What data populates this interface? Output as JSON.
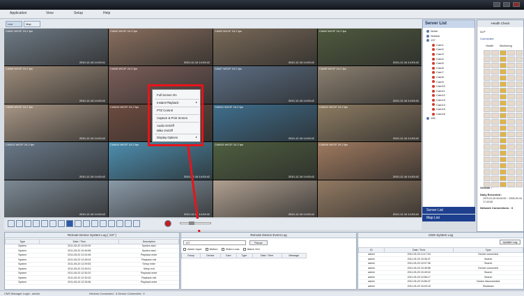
{
  "menu": {
    "items": [
      "Application",
      "View",
      "Setup",
      "Help"
    ]
  },
  "tabs": [
    {
      "label": "Live"
    },
    {
      "label": "Map"
    }
  ],
  "cameras": [
    {
      "label": "CAM1 W/CIF 24.2 fps",
      "ts": "2010-12-16 14:03:41"
    },
    {
      "label": "CAM2 W/CIF 24.2 fps",
      "ts": "2010-12-16 14:03:42"
    },
    {
      "label": "CAM3 W/CIF 24.2 fps",
      "ts": "2010-12-16 14:03:42"
    },
    {
      "label": "CAM4 W/CIF 24.2 fps",
      "ts": "2010-12-16 14:03:42"
    },
    {
      "label": "CAM5 W/CIF 24.2 fps",
      "ts": "2010-12-16 14:03:42"
    },
    {
      "label": "CAM6 W/CIF 24.2 fps",
      "ts": ""
    },
    {
      "label": "CAM7 W/CIF 24.2 fps",
      "ts": "2010-12-16 14:03:42"
    },
    {
      "label": "CAM8 W/CIF 24.2 fps",
      "ts": "2010-12-16 14:03:42"
    },
    {
      "label": "CAM9 W/CIF 24.2 fps",
      "ts": "2010-12-16 14:03:42"
    },
    {
      "label": "CAM10 W/CIF 24.2 fps",
      "ts": ""
    },
    {
      "label": "CAM11 W/CIF 24.2 fps",
      "ts": "2010-12-16 14:03:42"
    },
    {
      "label": "CAM12 W/CIF 24.2 fps",
      "ts": "2010-12-16 14:03:42"
    },
    {
      "label": "CAM13 W/CIF 24.2 fps",
      "ts": "2010-12-16 14:03:42"
    },
    {
      "label": "CAM14 W/CIF 24.2 fps",
      "ts": "2010-12-16 14:03:42"
    },
    {
      "label": "CAM15 W/CIF 24.2 fps",
      "ts": "2010-12-16 14:03:42"
    },
    {
      "label": "CAM16 W/CIF 24.2 fps",
      "ts": "2010-12-16 14:03:42"
    },
    {
      "label": "",
      "ts": "2010-12-16 14:03:42"
    },
    {
      "label": "",
      "ts": "2010-12-16 14:03:42"
    },
    {
      "label": "",
      "ts": "2010-12-16 14:03:42"
    },
    {
      "label": "",
      "ts": "2010-12-16 14:03:42"
    }
  ],
  "context_menu": {
    "items": [
      "Full Screen On",
      "Instant Playback",
      "PTZ Control",
      "Capture & Print Screen",
      "Audio On/Off",
      "Mike On/Off",
      "Display Options"
    ]
  },
  "server_list": {
    "title": "Server List",
    "items": [
      "Nvine",
      "Nvision",
      "137",
      "Cam1",
      "Cam2",
      "Cam3",
      "Cam4",
      "Cam5",
      "Cam6",
      "Cam7",
      "Cam8",
      "Cam9",
      "Cam10",
      "Cam11",
      "Cam12",
      "Cam13",
      "Cam14",
      "Cam15",
      "Cam16",
      "155"
    ]
  },
  "nav": {
    "server_list": "Server List",
    "map_list": "Map List"
  },
  "health": {
    "title": "Health Check",
    "name": "ALP",
    "connected": "Connected",
    "col_health": "Health",
    "col_monitoring": "Monitoring",
    "version_label": "Version :",
    "daily_label": "Daily Recorded :",
    "daily_value": "1970-01-00 00:00:00 ~ 2005-09-16 17:43:08",
    "net_label": "Network Connections :",
    "net_value": "3"
  },
  "system_log": {
    "title": "Remote Device System Log ( 137 )",
    "columns": [
      "Type",
      "Date / Time",
      "Description"
    ],
    "rows": [
      [
        "System",
        "2011-05-20 10:00:09",
        "System start"
      ],
      [
        "System",
        "2011-05-20 10:49:58",
        "System start"
      ],
      [
        "System",
        "2011-05-20 12:24:48",
        "Playback enter"
      ],
      [
        "System",
        "2011-05-20 12:28:04",
        "Playback exit"
      ],
      [
        "System",
        "2011-05-20 12:29:53",
        "Setup enter"
      ],
      [
        "System",
        "2011-05-20 12:30:01",
        "Setup exit"
      ],
      [
        "System",
        "2011-05-20 12:30:20",
        "Playback enter"
      ],
      [
        "System",
        "2011-05-20 12:32:03",
        "Playback exit"
      ],
      [
        "System",
        "2011-05-20 12:33:56",
        "Playback enter"
      ]
    ]
  },
  "event_log": {
    "title": "Remote Device Event Log",
    "device": "137",
    "pause": "Pause",
    "filters": [
      "Alarm Input",
      "Motion",
      "Video Loss",
      "Alarm Out"
    ],
    "columns": [
      "Group",
      "Device",
      "Cam",
      "Type",
      "Date / Time",
      "Message"
    ]
  },
  "cms_log": {
    "title": "CMS System Log",
    "update": "Update Log",
    "columns": [
      "ID",
      "Date / Time",
      "Type"
    ],
    "rows": [
      [
        "admin",
        "2011-05-20 14:17:04",
        "Device connected"
      ],
      [
        "admin",
        "2011-05-20 15:36:47",
        "Search"
      ],
      [
        "admin",
        "2011-05-20 15:37:36",
        "Search"
      ],
      [
        "admin",
        "2011-05-20 15:45:58",
        "Device connected"
      ],
      [
        "admin",
        "2011-05-20 15:49:32",
        "Search"
      ],
      [
        "admin",
        "2011-05-20 15:56:17",
        "Search"
      ],
      [
        "admin",
        "2011-05-20 15:56:47",
        "Device disconnected"
      ],
      [
        "admin",
        "2011-05-20 16:00:18",
        "Shutdown"
      ]
    ]
  },
  "status": {
    "login": "CMS Manager Login : admin",
    "devices": "Devices Connected : 3   Device Connected : 0"
  },
  "colors": {
    "highlight": "#e8141a",
    "nav": "#1d3f8e"
  }
}
